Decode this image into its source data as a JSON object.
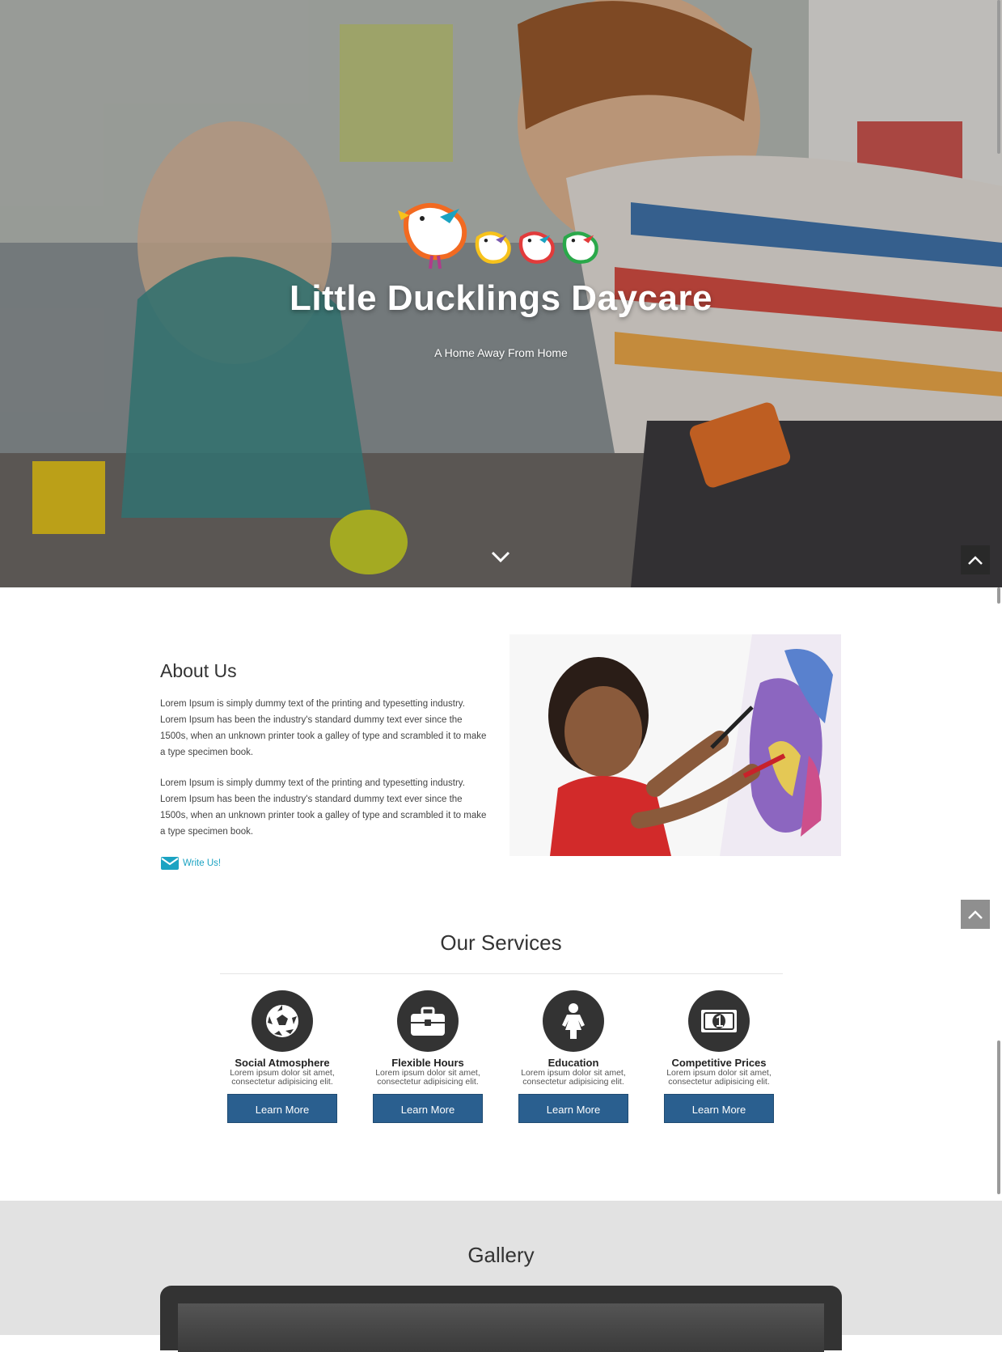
{
  "hero": {
    "title": "Little Ducklings Daycare",
    "tagline": "A Home Away From Home",
    "logo_icon": "ducklings-logo",
    "scroll_down_icon": "chevron-down-icon"
  },
  "back_to_top": {
    "icon": "chevron-up-icon"
  },
  "about": {
    "title": "About Us",
    "paragraphs": [
      "Lorem Ipsum is simply dummy text of the printing and typesetting industry. Lorem Ipsum has been the industry's standard dummy text ever since the 1500s, when an unknown printer took a galley of type and scrambled it to make a type specimen book.",
      "Lorem Ipsum is simply dummy text of the printing and typesetting industry. Lorem Ipsum has been the industry's standard dummy text ever since the 1500s, when an unknown printer took a galley of type and scrambled it to make a type specimen book."
    ],
    "write_us_label": "Write Us!",
    "write_us_icon": "envelope-icon",
    "link_color": "#1ba3c2"
  },
  "services": {
    "title": "Our Services",
    "button_color": "#2a5f8f",
    "items": [
      {
        "icon": "soccer-ball-icon",
        "title": "Social Atmosphere",
        "desc1": "Lorem ipsum dolor sit amet,",
        "desc2": "consectetur adipisicing elit.",
        "button": "Learn More"
      },
      {
        "icon": "briefcase-icon",
        "title": "Flexible Hours",
        "desc1": "Lorem ipsum dolor sit amet,",
        "desc2": "consectetur adipisicing elit.",
        "button": "Learn More"
      },
      {
        "icon": "child-icon",
        "title": "Education",
        "desc1": "Lorem ipsum dolor sit amet,",
        "desc2": "consectetur adipisicing elit.",
        "button": "Learn More"
      },
      {
        "icon": "money-bill-icon",
        "title": "Competitive Prices",
        "desc1": "Lorem ipsum dolor sit amet,",
        "desc2": "consectetur adipisicing elit.",
        "button": "Learn More"
      }
    ]
  },
  "gallery": {
    "title": "Gallery"
  }
}
